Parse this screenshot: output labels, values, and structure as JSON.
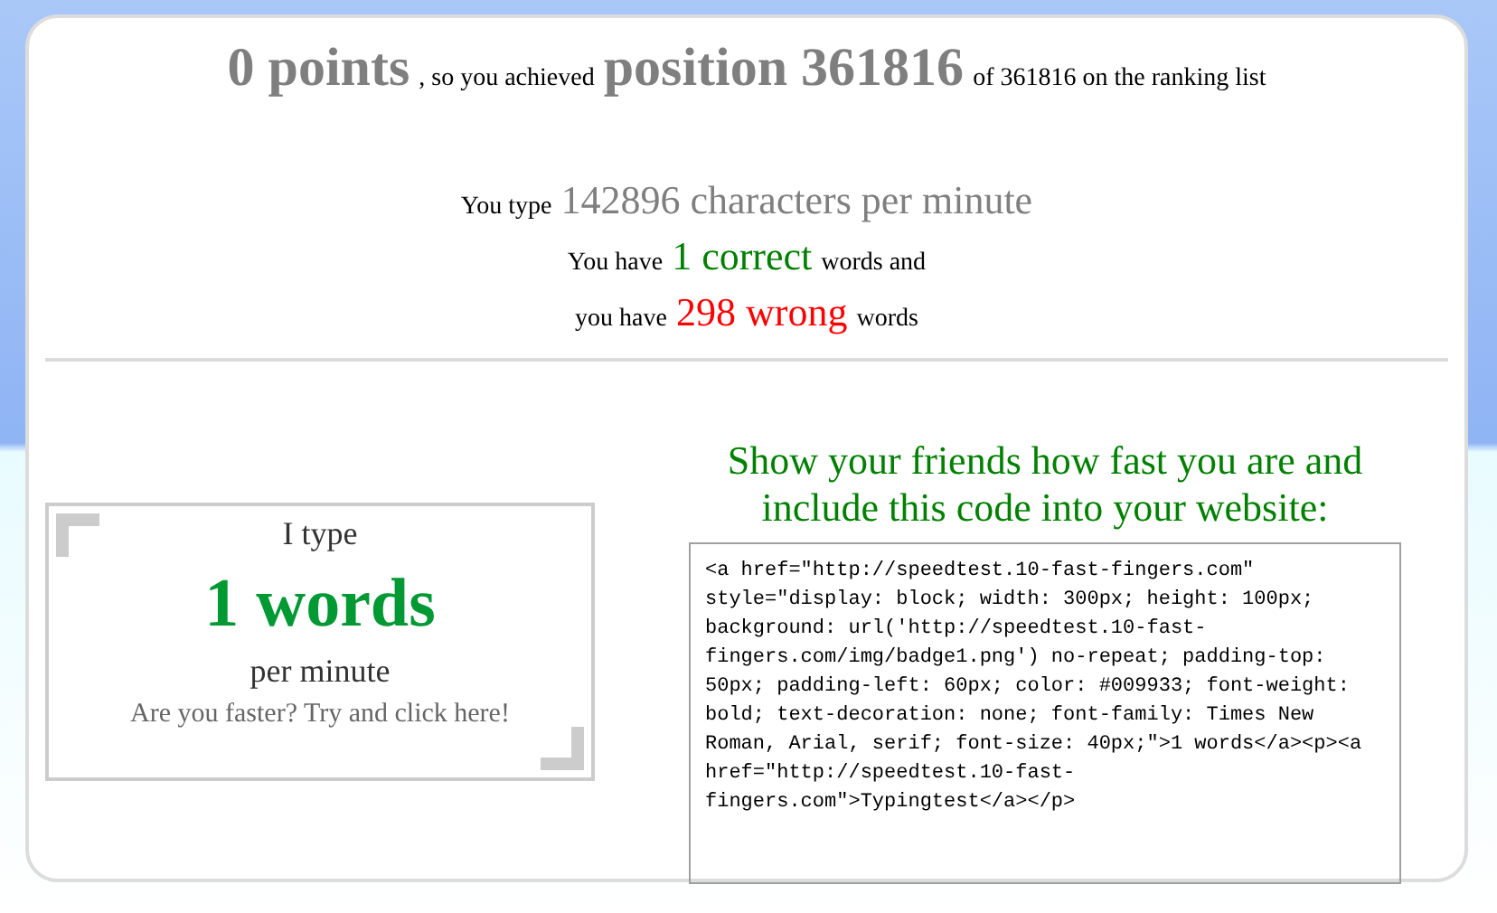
{
  "summary": [
    {
      "parts": [
        {
          "kind": "big",
          "text": "0 points"
        },
        {
          "kind": "plain",
          "text": ", so you achieved"
        },
        {
          "kind": "big",
          "text": "position 361816"
        },
        {
          "kind": "plain",
          "text": "of 361816 on the ranking list"
        }
      ]
    },
    {
      "parts": [
        {
          "kind": "plain",
          "text": "You type"
        },
        {
          "kind": "grey",
          "text": "142896 characters per minute"
        }
      ]
    },
    {
      "parts": [
        {
          "kind": "plain",
          "text": "You have"
        },
        {
          "kind": "good",
          "text": "1 correct"
        },
        {
          "kind": "plain",
          "text": "words and"
        }
      ]
    },
    {
      "parts": [
        {
          "kind": "plain",
          "text": "you have"
        },
        {
          "kind": "bad",
          "text": "298 wrong"
        },
        {
          "kind": "plain",
          "text": "words"
        }
      ]
    }
  ],
  "badge": {
    "intro": "I type",
    "score": "1 words",
    "unit": "per minute",
    "link": "Are you faster? Try and click here!"
  },
  "share": {
    "heading": "Show your friends how fast you are and include this code into your website:",
    "code": "<a href=\"http://speedtest.10-fast-fingers.com\" style=\"display: block; width: 300px; height: 100px; background: url('http://speedtest.10-fast-fingers.com/img/badge1.png') no-repeat; padding-top: 50px; padding-left: 60px; color: #009933; font-weight: bold; text-decoration: none; font-family: Times New Roman, Arial, serif; font-size: 40px;\">1 words</a><p><a href=\"http://speedtest.10-fast-fingers.com\">Typingtest</a></p>"
  }
}
